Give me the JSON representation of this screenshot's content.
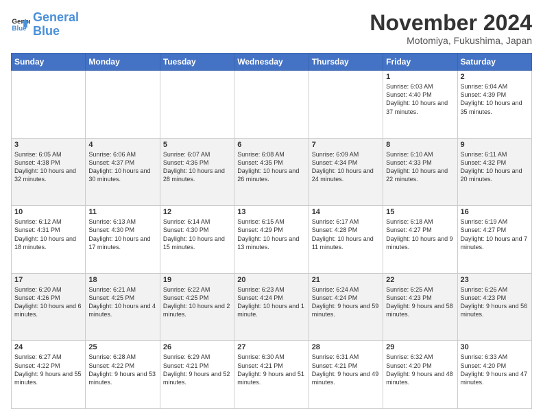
{
  "logo": {
    "line1": "General",
    "line2": "Blue"
  },
  "title": "November 2024",
  "subtitle": "Motomiya, Fukushima, Japan",
  "days_of_week": [
    "Sunday",
    "Monday",
    "Tuesday",
    "Wednesday",
    "Thursday",
    "Friday",
    "Saturday"
  ],
  "weeks": [
    [
      null,
      null,
      null,
      null,
      null,
      {
        "num": "1",
        "rise": "6:03 AM",
        "set": "4:40 PM",
        "daylight": "10 hours and 37 minutes."
      },
      {
        "num": "2",
        "rise": "6:04 AM",
        "set": "4:39 PM",
        "daylight": "10 hours and 35 minutes."
      }
    ],
    [
      {
        "num": "3",
        "rise": "6:05 AM",
        "set": "4:38 PM",
        "daylight": "10 hours and 32 minutes."
      },
      {
        "num": "4",
        "rise": "6:06 AM",
        "set": "4:37 PM",
        "daylight": "10 hours and 30 minutes."
      },
      {
        "num": "5",
        "rise": "6:07 AM",
        "set": "4:36 PM",
        "daylight": "10 hours and 28 minutes."
      },
      {
        "num": "6",
        "rise": "6:08 AM",
        "set": "4:35 PM",
        "daylight": "10 hours and 26 minutes."
      },
      {
        "num": "7",
        "rise": "6:09 AM",
        "set": "4:34 PM",
        "daylight": "10 hours and 24 minutes."
      },
      {
        "num": "8",
        "rise": "6:10 AM",
        "set": "4:33 PM",
        "daylight": "10 hours and 22 minutes."
      },
      {
        "num": "9",
        "rise": "6:11 AM",
        "set": "4:32 PM",
        "daylight": "10 hours and 20 minutes."
      }
    ],
    [
      {
        "num": "10",
        "rise": "6:12 AM",
        "set": "4:31 PM",
        "daylight": "10 hours and 18 minutes."
      },
      {
        "num": "11",
        "rise": "6:13 AM",
        "set": "4:30 PM",
        "daylight": "10 hours and 17 minutes."
      },
      {
        "num": "12",
        "rise": "6:14 AM",
        "set": "4:30 PM",
        "daylight": "10 hours and 15 minutes."
      },
      {
        "num": "13",
        "rise": "6:15 AM",
        "set": "4:29 PM",
        "daylight": "10 hours and 13 minutes."
      },
      {
        "num": "14",
        "rise": "6:17 AM",
        "set": "4:28 PM",
        "daylight": "10 hours and 11 minutes."
      },
      {
        "num": "15",
        "rise": "6:18 AM",
        "set": "4:27 PM",
        "daylight": "10 hours and 9 minutes."
      },
      {
        "num": "16",
        "rise": "6:19 AM",
        "set": "4:27 PM",
        "daylight": "10 hours and 7 minutes."
      }
    ],
    [
      {
        "num": "17",
        "rise": "6:20 AM",
        "set": "4:26 PM",
        "daylight": "10 hours and 6 minutes."
      },
      {
        "num": "18",
        "rise": "6:21 AM",
        "set": "4:25 PM",
        "daylight": "10 hours and 4 minutes."
      },
      {
        "num": "19",
        "rise": "6:22 AM",
        "set": "4:25 PM",
        "daylight": "10 hours and 2 minutes."
      },
      {
        "num": "20",
        "rise": "6:23 AM",
        "set": "4:24 PM",
        "daylight": "10 hours and 1 minute."
      },
      {
        "num": "21",
        "rise": "6:24 AM",
        "set": "4:24 PM",
        "daylight": "9 hours and 59 minutes."
      },
      {
        "num": "22",
        "rise": "6:25 AM",
        "set": "4:23 PM",
        "daylight": "9 hours and 58 minutes."
      },
      {
        "num": "23",
        "rise": "6:26 AM",
        "set": "4:23 PM",
        "daylight": "9 hours and 56 minutes."
      }
    ],
    [
      {
        "num": "24",
        "rise": "6:27 AM",
        "set": "4:22 PM",
        "daylight": "9 hours and 55 minutes."
      },
      {
        "num": "25",
        "rise": "6:28 AM",
        "set": "4:22 PM",
        "daylight": "9 hours and 53 minutes."
      },
      {
        "num": "26",
        "rise": "6:29 AM",
        "set": "4:21 PM",
        "daylight": "9 hours and 52 minutes."
      },
      {
        "num": "27",
        "rise": "6:30 AM",
        "set": "4:21 PM",
        "daylight": "9 hours and 51 minutes."
      },
      {
        "num": "28",
        "rise": "6:31 AM",
        "set": "4:21 PM",
        "daylight": "9 hours and 49 minutes."
      },
      {
        "num": "29",
        "rise": "6:32 AM",
        "set": "4:20 PM",
        "daylight": "9 hours and 48 minutes."
      },
      {
        "num": "30",
        "rise": "6:33 AM",
        "set": "4:20 PM",
        "daylight": "9 hours and 47 minutes."
      }
    ]
  ]
}
